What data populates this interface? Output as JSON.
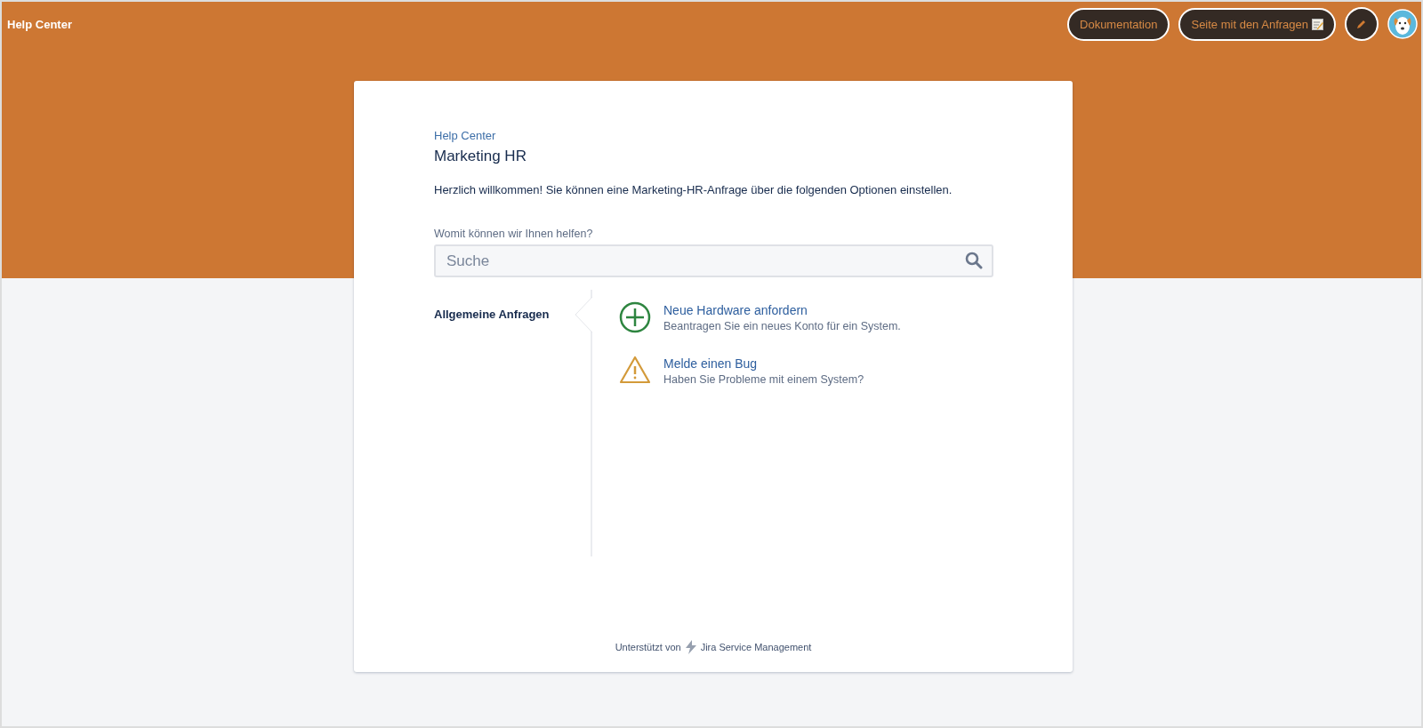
{
  "header": {
    "title": "Help Center",
    "buttons": [
      {
        "kind": "text",
        "label": "Dokumentation"
      },
      {
        "kind": "memo",
        "label": "Seite mit den Anfragen"
      },
      {
        "kind": "edit"
      },
      {
        "kind": "avatar"
      }
    ]
  },
  "card": {
    "breadcrumb": "Help Center",
    "title": "Marketing HR",
    "welcome": "Herzlich willkommen! Sie können eine Marketing-HR-Anfrage über die folgenden Optionen einstellen.",
    "search_label": "Womit können wir Ihnen helfen?",
    "search": {
      "placeholder": "Suche"
    },
    "groups": [
      {
        "label": "Allgemeine Anfragen",
        "selected": true
      }
    ],
    "request_types": [
      {
        "kind": "plus",
        "title": "Neue Hardware anfordern",
        "description": "Beantragen Sie ein neues Konto für ein System."
      },
      {
        "kind": "warning",
        "title": "Melde einen Bug",
        "description": "Haben Sie Probleme mit einem System?"
      }
    ],
    "footer": {
      "prefix": "Unterstützt von",
      "product": "Jira Service Management"
    }
  }
}
